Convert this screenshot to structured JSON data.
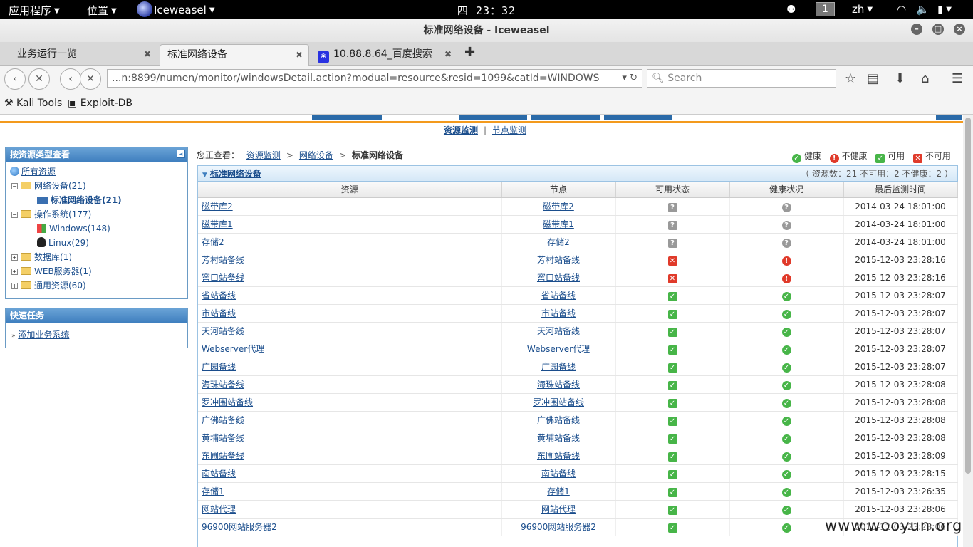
{
  "topbar": {
    "apps_menu": "应用程序",
    "places_menu": "位置",
    "app_name": "Iceweasel",
    "clock": "四 23：32",
    "workspace": "1",
    "input_method": "zh"
  },
  "window": {
    "title": "标准网络设备 - Iceweasel"
  },
  "tabs": [
    {
      "label": "业务运行一览"
    },
    {
      "label": "标准网络设备"
    },
    {
      "label": "10.88.8.64_百度搜索"
    }
  ],
  "nav": {
    "url": "...n:8899/numen/monitor/windowsDetail.action?modual=resource&resid=1099&catId=WINDOWS",
    "search_placeholder": "Search"
  },
  "bookmarks": [
    {
      "label": "Kali Tools"
    },
    {
      "label": "Exploit-DB"
    }
  ],
  "subnav": {
    "item1": "资源监测",
    "sep": "|",
    "item2": "节点监测"
  },
  "left_panel": {
    "title": "按资源类型查看",
    "tree": {
      "root": "所有资源",
      "network": "网络设备(21)",
      "network_std": "标准网络设备(21)",
      "os": "操作系统(177)",
      "windows": "Windows(148)",
      "linux": "Linux(29)",
      "db": "数据库(1)",
      "web": "WEB服务器(1)",
      "general": "通用资源(60)"
    }
  },
  "quick_tasks": {
    "title": "快速任务",
    "add_system": "添加业务系统"
  },
  "breadcrumb": {
    "prefix": "您正查看：",
    "level1": "资源监测",
    "level2": "网络设备",
    "current": "标准网络设备"
  },
  "legend": {
    "healthy": "健康",
    "unhealthy": "不健康",
    "available": "可用",
    "unavailable": "不可用"
  },
  "table": {
    "title": "标准网络设备",
    "summary": "（ 资源数：21   不可用：2   不健康：2 ）",
    "columns": [
      "资源",
      "节点",
      "可用状态",
      "健康状况",
      "最后监测时间"
    ],
    "rows": [
      {
        "resource": "磁带库2",
        "node": "磁带库2",
        "availability": "unknown",
        "health": "unknown",
        "time": "2014-03-24 18:01:00"
      },
      {
        "resource": "磁带库1",
        "node": "磁带库1",
        "availability": "unknown",
        "health": "unknown",
        "time": "2014-03-24 18:01:00"
      },
      {
        "resource": "存储2",
        "node": "存储2",
        "availability": "unknown",
        "health": "unknown",
        "time": "2014-03-24 18:01:00"
      },
      {
        "resource": "芳村站备线",
        "node": "芳村站备线",
        "availability": "unavailable",
        "health": "unhealthy",
        "time": "2015-12-03 23:28:16"
      },
      {
        "resource": "窖口站备线",
        "node": "窖口站备线",
        "availability": "unavailable",
        "health": "unhealthy",
        "time": "2015-12-03 23:28:16"
      },
      {
        "resource": "省站备线",
        "node": "省站备线",
        "availability": "available",
        "health": "healthy",
        "time": "2015-12-03 23:28:07"
      },
      {
        "resource": "市站备线",
        "node": "市站备线",
        "availability": "available",
        "health": "healthy",
        "time": "2015-12-03 23:28:07"
      },
      {
        "resource": "天河站备线",
        "node": "天河站备线",
        "availability": "available",
        "health": "healthy",
        "time": "2015-12-03 23:28:07"
      },
      {
        "resource": "Webserver代理",
        "node": "Webserver代理",
        "availability": "available",
        "health": "healthy",
        "time": "2015-12-03 23:28:07"
      },
      {
        "resource": "广园备线",
        "node": "广园备线",
        "availability": "available",
        "health": "healthy",
        "time": "2015-12-03 23:28:07"
      },
      {
        "resource": "海珠站备线",
        "node": "海珠站备线",
        "availability": "available",
        "health": "healthy",
        "time": "2015-12-03 23:28:08"
      },
      {
        "resource": "罗冲围站备线",
        "node": "罗冲围站备线",
        "availability": "available",
        "health": "healthy",
        "time": "2015-12-03 23:28:08"
      },
      {
        "resource": "广佛站备线",
        "node": "广佛站备线",
        "availability": "available",
        "health": "healthy",
        "time": "2015-12-03 23:28:08"
      },
      {
        "resource": "黄埔站备线",
        "node": "黄埔站备线",
        "availability": "available",
        "health": "healthy",
        "time": "2015-12-03 23:28:08"
      },
      {
        "resource": "东圃站备线",
        "node": "东圃站备线",
        "availability": "available",
        "health": "healthy",
        "time": "2015-12-03 23:28:09"
      },
      {
        "resource": "南站备线",
        "node": "南站备线",
        "availability": "available",
        "health": "healthy",
        "time": "2015-12-03 23:28:15"
      },
      {
        "resource": "存储1",
        "node": "存储1",
        "availability": "available",
        "health": "healthy",
        "time": "2015-12-03 23:26:35"
      },
      {
        "resource": "网站代理",
        "node": "网站代理",
        "availability": "available",
        "health": "healthy",
        "time": "2015-12-03 23:28:06"
      },
      {
        "resource": "96900网站服务器2",
        "node": "96900网站服务器2",
        "availability": "available",
        "health": "healthy",
        "time": "2015-12-03 23:28:06"
      }
    ]
  },
  "watermark": "www.wooyun.org",
  "colors": {
    "accent_orange": "#f39a1d",
    "header_blue": "#3f7fbf",
    "link_blue": "#1a4d8c",
    "ok_green": "#47b548",
    "bad_red": "#e03a2a"
  }
}
